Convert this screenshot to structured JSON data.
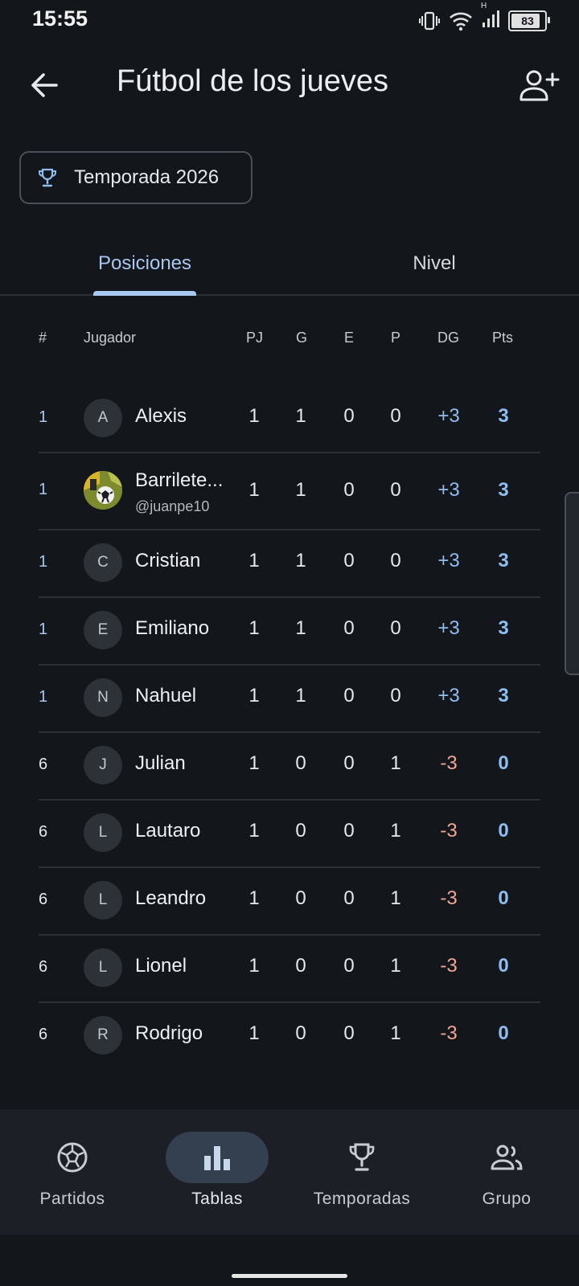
{
  "status_bar": {
    "time": "15:55",
    "battery": "83",
    "network": "H"
  },
  "header": {
    "title": "Fútbol de los jueves"
  },
  "season": {
    "label": "Temporada 2026"
  },
  "tabs": [
    {
      "label": "Posiciones",
      "active": true
    },
    {
      "label": "Nivel",
      "active": false
    }
  ],
  "table": {
    "headers": {
      "rank": "#",
      "player": "Jugador",
      "pj": "PJ",
      "g": "G",
      "e": "E",
      "p": "P",
      "dg": "DG",
      "pts": "Pts"
    },
    "rows": [
      {
        "rank": "1",
        "initial": "A",
        "name": "Alexis",
        "handle": "",
        "pj": "1",
        "g": "1",
        "e": "0",
        "p": "0",
        "dg": "+3",
        "pts": "3"
      },
      {
        "rank": "1",
        "initial": "",
        "name": "Barrilete...",
        "handle": "@juanpe10",
        "pj": "1",
        "g": "1",
        "e": "0",
        "p": "0",
        "dg": "+3",
        "pts": "3"
      },
      {
        "rank": "1",
        "initial": "C",
        "name": "Cristian",
        "handle": "",
        "pj": "1",
        "g": "1",
        "e": "0",
        "p": "0",
        "dg": "+3",
        "pts": "3"
      },
      {
        "rank": "1",
        "initial": "E",
        "name": "Emiliano",
        "handle": "",
        "pj": "1",
        "g": "1",
        "e": "0",
        "p": "0",
        "dg": "+3",
        "pts": "3"
      },
      {
        "rank": "1",
        "initial": "N",
        "name": "Nahuel",
        "handle": "",
        "pj": "1",
        "g": "1",
        "e": "0",
        "p": "0",
        "dg": "+3",
        "pts": "3"
      },
      {
        "rank": "6",
        "initial": "J",
        "name": "Julian",
        "handle": "",
        "pj": "1",
        "g": "0",
        "e": "0",
        "p": "1",
        "dg": "-3",
        "pts": "0"
      },
      {
        "rank": "6",
        "initial": "L",
        "name": "Lautaro",
        "handle": "",
        "pj": "1",
        "g": "0",
        "e": "0",
        "p": "1",
        "dg": "-3",
        "pts": "0"
      },
      {
        "rank": "6",
        "initial": "L",
        "name": "Leandro",
        "handle": "",
        "pj": "1",
        "g": "0",
        "e": "0",
        "p": "1",
        "dg": "-3",
        "pts": "0"
      },
      {
        "rank": "6",
        "initial": "L",
        "name": "Lionel",
        "handle": "",
        "pj": "1",
        "g": "0",
        "e": "0",
        "p": "1",
        "dg": "-3",
        "pts": "0"
      },
      {
        "rank": "6",
        "initial": "R",
        "name": "Rodrigo",
        "handle": "",
        "pj": "1",
        "g": "0",
        "e": "0",
        "p": "1",
        "dg": "-3",
        "pts": "0"
      }
    ]
  },
  "bottom_nav": [
    {
      "label": "Partidos",
      "icon": "soccer-ball-icon",
      "active": false
    },
    {
      "label": "Tablas",
      "icon": "bar-chart-icon",
      "active": true
    },
    {
      "label": "Temporadas",
      "icon": "trophy-icon",
      "active": false
    },
    {
      "label": "Grupo",
      "icon": "group-icon",
      "active": false
    }
  ],
  "colors": {
    "background": "#13161b",
    "accent": "#a8c8f0",
    "positive": "#8fbdf0",
    "negative": "#f2a593",
    "nav_bg": "#1c1f25"
  }
}
